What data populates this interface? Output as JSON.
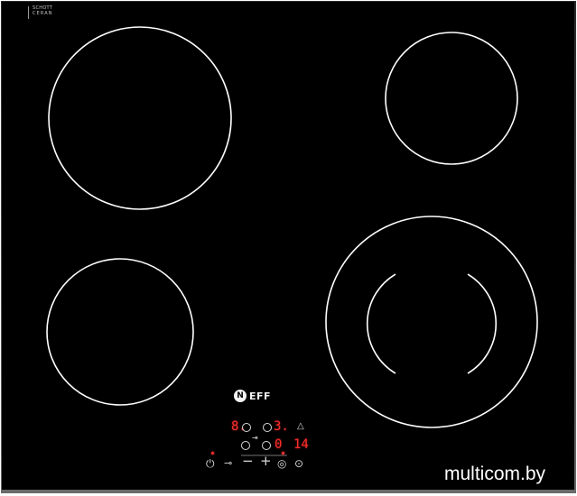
{
  "glass": {
    "brand_line1": "SCHOTT",
    "brand_line2": "CERAN"
  },
  "logo": {
    "badge": "N",
    "text": "EFF"
  },
  "controls": {
    "display_left": "8.",
    "display_right": "3.",
    "timer_minus_digit": "0",
    "timer_digits": "14",
    "power_icon": "power-icon",
    "lock_icon": "key-icon",
    "minus": "−",
    "plus": "+",
    "timer_icon": "timer-icon",
    "check_icon": "check-icon",
    "warm_icon": "triangle-icon",
    "skip_icon": "skip-icon"
  },
  "watermark": "multicom.by",
  "colors": {
    "glass": "#000000",
    "ring": "#ffffff",
    "led": "#ff2d2d",
    "frame": "#3a3a3a"
  }
}
